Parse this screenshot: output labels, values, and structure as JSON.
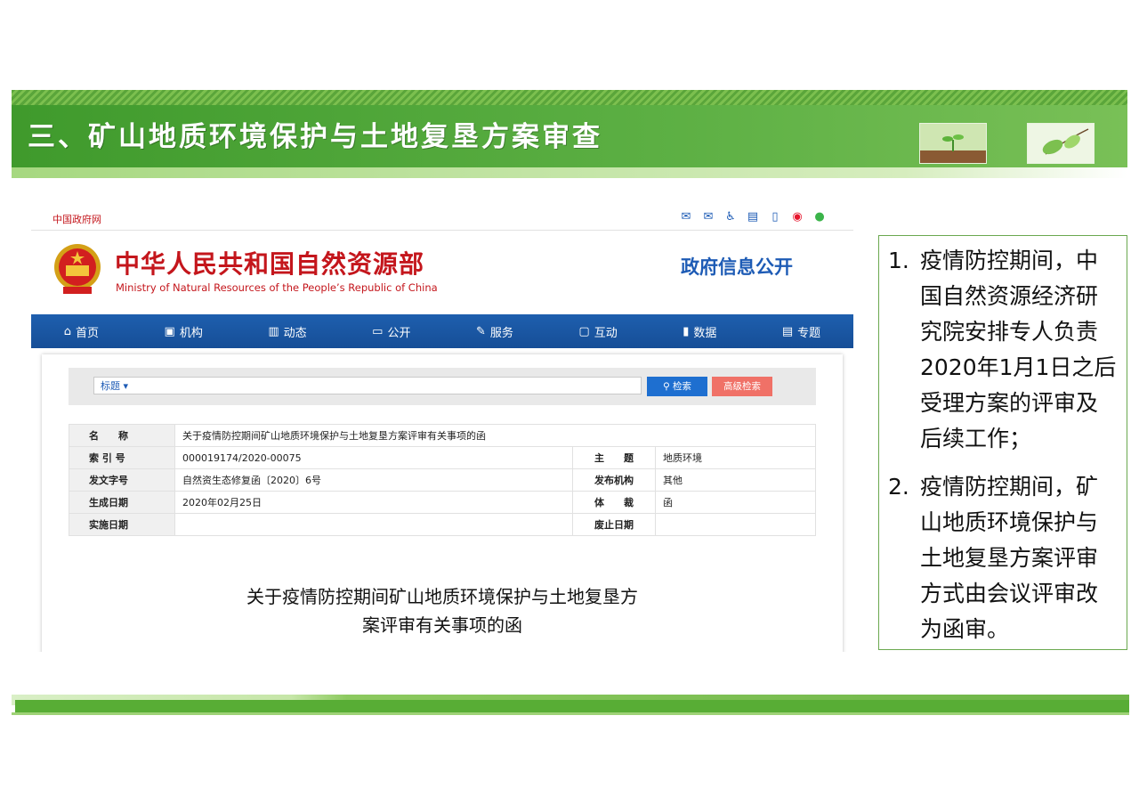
{
  "slide": {
    "title": "三、矿山地质环境保护与土地复垦方案审查"
  },
  "website": {
    "gov_link": "中国政府网",
    "ministry_name_cn": "中华人民共和国自然资源部",
    "ministry_name_en": "Ministry of Natural Resources of the People’s Republic of China",
    "section_title": "政府信息公开",
    "nav": [
      {
        "label": "首页",
        "icon": "home-icon"
      },
      {
        "label": "机构",
        "icon": "org-icon"
      },
      {
        "label": "动态",
        "icon": "book-icon"
      },
      {
        "label": "公开",
        "icon": "monitor-icon"
      },
      {
        "label": "服务",
        "icon": "edit-icon"
      },
      {
        "label": "互动",
        "icon": "chat-icon"
      },
      {
        "label": "数据",
        "icon": "bar-chart-icon"
      },
      {
        "label": "专题",
        "icon": "topic-icon"
      }
    ],
    "search": {
      "field_select": "标题 ▾",
      "search_button": "检索",
      "advanced_button": "高级检索"
    },
    "meta": {
      "name_label": "名　　称",
      "name_value": "关于疫情防控期间矿山地质环境保护与土地复垦方案评审有关事项的函",
      "index_label": "索 引 号",
      "index_value": "000019174/2020-00075",
      "subject_label": "主　　题",
      "subject_value": "地质环境",
      "doc_no_label": "发文字号",
      "doc_no_value": "自然资生态修复函〔2020〕6号",
      "publisher_label": "发布机构",
      "publisher_value": "其他",
      "date_label": "生成日期",
      "date_value": "2020年02月25日",
      "genre_label": "体　　裁",
      "genre_value": "函",
      "effective_label": "实施日期",
      "effective_value": "",
      "expiry_label": "废止日期",
      "expiry_value": ""
    },
    "document_title_line1": "关于疫情防控期间矿山地质环境保护与土地复垦方",
    "document_title_line2": "案评审有关事项的函"
  },
  "notes": [
    {
      "num": "1.",
      "text": "疫情防控期间，中国自然资源经济研究院安排专人负责2020年1月1日之后受理方案的评审及后续工作；"
    },
    {
      "num": "2.",
      "text": "疫情防控期间，矿山地质环境保护与土地复垦方案评审方式由会议评审改为函审。"
    }
  ],
  "colors": {
    "brand_red": "#c4161c",
    "nav_blue": "#1e5fae",
    "slide_green": "#58ad35"
  }
}
